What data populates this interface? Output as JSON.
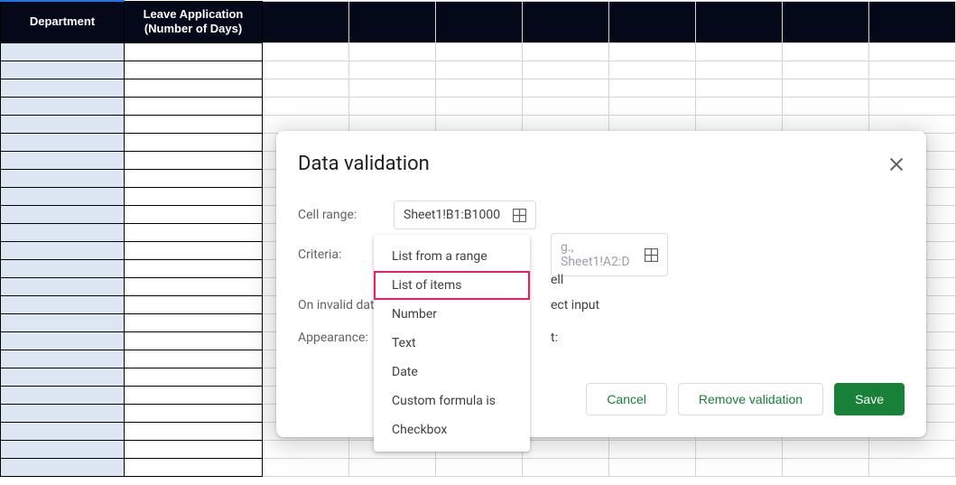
{
  "spreadsheet": {
    "headers": {
      "col_a": "Department",
      "col_b": "Leave Application (Number of Days)"
    }
  },
  "dialog": {
    "title": "Data validation",
    "labels": {
      "cell_range": "Cell range:",
      "criteria": "Criteria:",
      "on_invalid": "On invalid data:",
      "appearance": "Appearance:"
    },
    "cell_range_value": "Sheet1!B1:B1000",
    "criteria_range_placeholder": "g., Sheet1!A2:D",
    "partial_cell": "ell",
    "partial_invalid": "ect input",
    "partial_appearance": "t:",
    "dropdown": {
      "items": [
        "List from a range",
        "List of items",
        "Number",
        "Text",
        "Date",
        "Custom formula is",
        "Checkbox"
      ],
      "highlighted_index": 1
    },
    "buttons": {
      "cancel": "Cancel",
      "remove": "Remove validation",
      "save": "Save"
    }
  }
}
